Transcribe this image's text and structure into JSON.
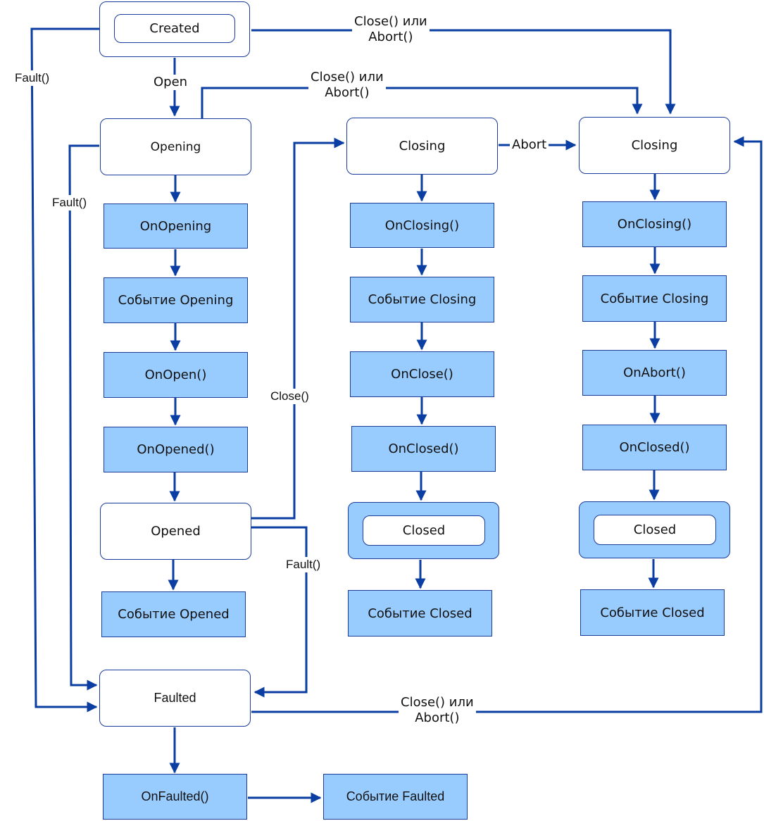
{
  "diagram": {
    "colors": {
      "line": "#0a3ea3",
      "border": "#1a3c9c",
      "action_fill": "#99ccfe",
      "state_fill": "#ffffff"
    },
    "nodes": {
      "created": "Created",
      "opening": "Opening",
      "on_opening": "OnOpening",
      "event_opening": "Событие Opening",
      "on_open": "OnOpen()",
      "on_opened": "OnOpened()",
      "opened": "Opened",
      "event_opened": "Событие Opened",
      "closing_1": "Closing",
      "on_closing_1": "OnClosing()",
      "event_closing_1": "Событие Closing",
      "on_close_1": "OnClose()",
      "on_closed_1": "OnClosed()",
      "closed_1": "Closed",
      "event_closed_1": "Событие Closed",
      "closing_2": "Closing",
      "on_closing_2": "OnClosing()",
      "event_closing_2": "Событие Closing",
      "on_abort_2": "OnAbort()",
      "on_closed_2": "OnClosed()",
      "closed_2": "Closed",
      "event_closed_2": "Событие Closed",
      "faulted": "Faulted",
      "on_faulted": "OnFaulted()",
      "event_faulted": "Событие Faulted"
    },
    "edge_labels": {
      "open": "Open",
      "created_fault": "Fault()",
      "opening_fault": "Fault()",
      "created_close_abort": "Close() или\nAbort()",
      "opening_close_abort": "Close() или\nAbort()",
      "abort": "Abort",
      "opened_close": "Close()",
      "opened_fault": "Fault()",
      "faulted_close_abort": "Close() или\nAbort()"
    }
  }
}
